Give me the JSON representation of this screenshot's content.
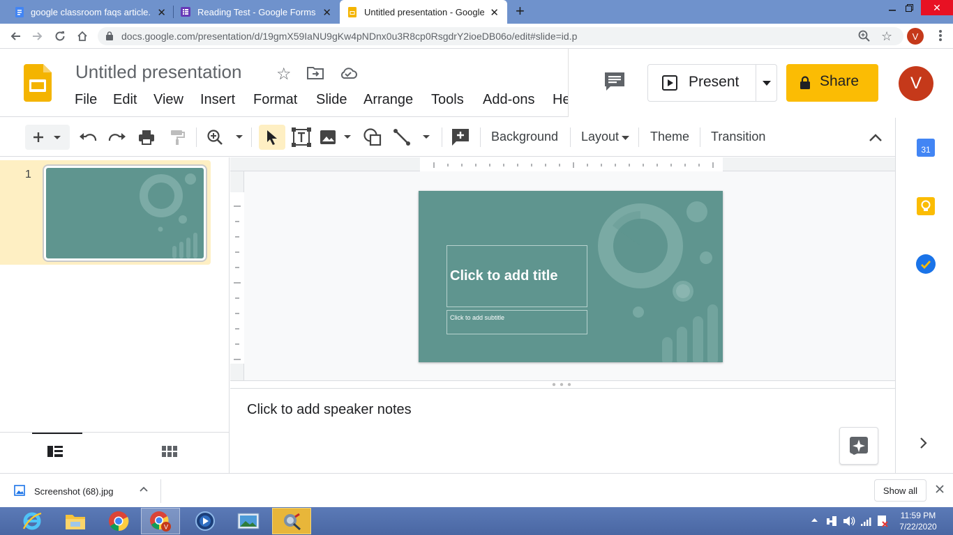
{
  "browser": {
    "tabs": [
      {
        "title": "google classroom faqs article.do",
        "icon": "docs-icon",
        "active": false
      },
      {
        "title": "Reading Test - Google Forms",
        "icon": "forms-icon",
        "active": false
      },
      {
        "title": "Untitled presentation - Google Sl",
        "icon": "slides-icon",
        "active": true
      }
    ],
    "new_tab": "+",
    "url": "docs.google.com/presentation/d/19gmX59IaNU9gKw4pNDnx0u3R8cp0RsgdrY2ioeDB06o/edit#slide=id.p",
    "profile_initial": "V"
  },
  "doc": {
    "title": "Untitled presentation",
    "menu": [
      "File",
      "Edit",
      "View",
      "Insert",
      "Format",
      "Slide",
      "Arrange",
      "Tools",
      "Add-ons",
      "He"
    ],
    "present_label": "Present",
    "share_label": "Share",
    "avatar_initial": "V"
  },
  "toolbar": {
    "background": "Background",
    "layout": "Layout",
    "theme": "Theme",
    "transition": "Transition"
  },
  "filmstrip": {
    "slide_number": "1"
  },
  "slide": {
    "title_placeholder": "Click to add title",
    "subtitle_placeholder": "Click to add subtitle",
    "bg_color": "#5f958f"
  },
  "notes": {
    "placeholder": "Click to add speaker notes"
  },
  "side_panel": {
    "calendar_day": "31"
  },
  "downloads": {
    "file": "Screenshot (68).jpg",
    "show_all": "Show all"
  },
  "taskbar": {
    "time": "11:59 PM",
    "date": "7/22/2020"
  },
  "colors": {
    "share": "#fbbc04",
    "avatar": "#c5391a",
    "tabstrip": "#6f92cc",
    "slides_yellow": "#f4b400"
  }
}
